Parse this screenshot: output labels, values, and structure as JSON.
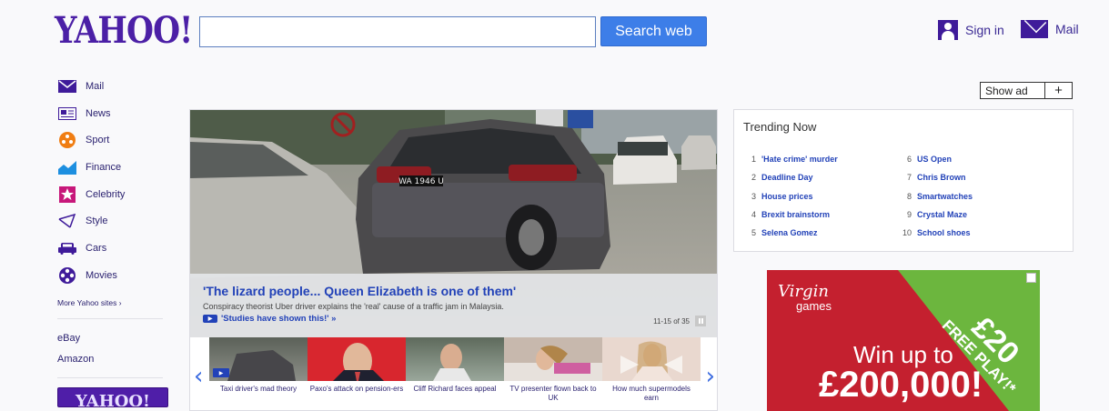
{
  "header": {
    "logo": "YAHOO!",
    "search_value": "",
    "search_button": "Search web",
    "signin_label": "Sign in",
    "mail_label": "Mail"
  },
  "sidebar": {
    "items": [
      {
        "label": "Mail",
        "icon": "envelope-icon"
      },
      {
        "label": "News",
        "icon": "newspaper-icon"
      },
      {
        "label": "Sport",
        "icon": "sport-icon"
      },
      {
        "label": "Finance",
        "icon": "chart-icon"
      },
      {
        "label": "Celebrity",
        "icon": "star-icon"
      },
      {
        "label": "Style",
        "icon": "hanger-icon"
      },
      {
        "label": "Cars",
        "icon": "car-icon"
      },
      {
        "label": "Movies",
        "icon": "film-reel-icon"
      }
    ],
    "more_sites": "More Yahoo sites ›",
    "links": [
      "eBay",
      "Amazon"
    ],
    "promo": "YAHOO!"
  },
  "hero": {
    "title": "'The lizard people... Queen Elizabeth is one of them'",
    "description": "Conspiracy theorist Uber driver explains the 'real' cause of a traffic jam in Malaysia.",
    "video_link": "'Studies have shown this!' »",
    "counter": "11-15 of 35",
    "plate": "WA 1946 U",
    "thumbs": [
      {
        "caption": "Taxi driver's mad theory",
        "video": true
      },
      {
        "caption": "Paxo's attack on pension-ers",
        "video": false
      },
      {
        "caption": "Cliff Richard faces appeal",
        "video": false
      },
      {
        "caption": "TV presenter flown back to UK",
        "video": false
      },
      {
        "caption": "How much supermodels earn",
        "video": false
      }
    ],
    "prev_arrow": "‹",
    "next_arrow": "›"
  },
  "ad_toggle": {
    "label": "Show ad",
    "plus": "+"
  },
  "trending": {
    "title": "Trending Now",
    "left": [
      {
        "num": "1",
        "text": "'Hate crime' murder"
      },
      {
        "num": "2",
        "text": "Deadline Day"
      },
      {
        "num": "3",
        "text": "House prices"
      },
      {
        "num": "4",
        "text": "Brexit brainstorm"
      },
      {
        "num": "5",
        "text": "Selena Gomez"
      }
    ],
    "right": [
      {
        "num": "6",
        "text": "US Open"
      },
      {
        "num": "7",
        "text": "Chris Brown"
      },
      {
        "num": "8",
        "text": "Smartwatches"
      },
      {
        "num": "9",
        "text": "Crystal Maze"
      },
      {
        "num": "10",
        "text": "School shoes"
      }
    ]
  },
  "ad": {
    "brand": "Virgin",
    "brand_sub": "games",
    "free_amount": "£20",
    "free_text": "FREE PLAY!*",
    "win_text": "Win up to",
    "prize": "£200,000!"
  },
  "colors": {
    "brand": "#4b1fa6",
    "link": "#2242b8",
    "button": "#3d7ee8",
    "ad_red": "#c4202f",
    "ad_green": "#6cb63e"
  }
}
